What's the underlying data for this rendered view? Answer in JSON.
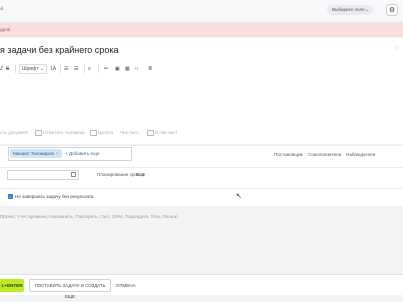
{
  "header": {
    "title_fragment": "а",
    "role_select": "Выберите поле",
    "settings_icon": "gear-icon"
  },
  "alert": {
    "text": "дров"
  },
  "task": {
    "title": "я задачи без крайнего срока"
  },
  "toolbar": {
    "font": "Шрифт",
    "size": "1A"
  },
  "editor_options": [
    "сть документ",
    "Отметить человека",
    "Цитата",
    "Чек-лист",
    "В чек-лист"
  ],
  "people": {
    "chip": "Михаил Тихомиров",
    "add_more": "+ Добавить еще",
    "roles": [
      "Постановщик",
      "Соисполнители",
      "Наблюдатели"
    ]
  },
  "deadline": {
    "plan": "Планирование сроков",
    "more": "Еще"
  },
  "checkbox": {
    "label": "Не завершать задачу без результата",
    "checked": true
  },
  "extra_links": "Проект,  Учет времени,  Напомнить,  Повторять,  Гант,  CRM,  Подзадача,  Теги,  Пользо",
  "footer": {
    "send": "L+ENTER",
    "create_more": "ПОСТАВИТЬ ЗАДАЧУ И СОЗДАТЬ ЕЩЕ",
    "cancel": "ОТМЕНА"
  }
}
